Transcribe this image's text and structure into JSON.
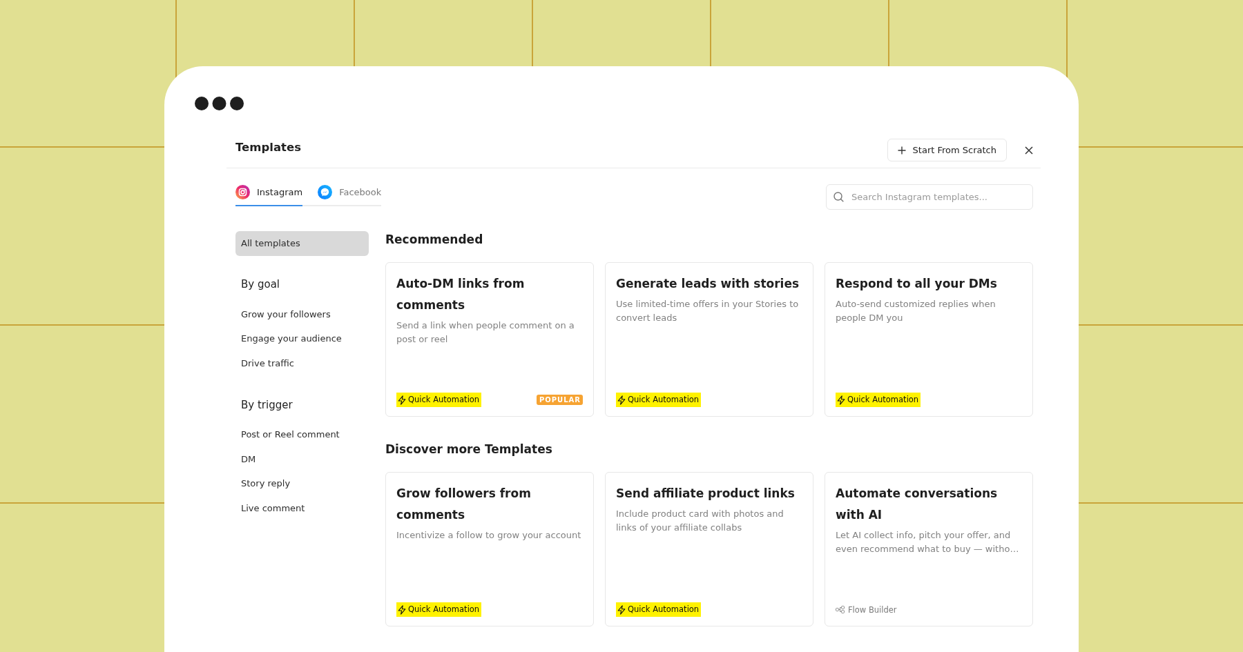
{
  "header": {
    "title": "Templates",
    "start_button": "Start From Scratch"
  },
  "tabs": [
    {
      "label": "Instagram",
      "kind": "camera",
      "selected": true
    },
    {
      "label": "Facebook",
      "kind": "chat",
      "selected": false
    }
  ],
  "search": {
    "placeholder": "Search Instagram templates..."
  },
  "sidebar": {
    "items": [
      {
        "label": "All templates",
        "selected": true
      }
    ],
    "groups": [
      {
        "title": "By goal",
        "items": [
          {
            "label": "Grow your followers",
            "selected": false
          },
          {
            "label": "Engage your audience",
            "selected": false
          },
          {
            "label": "Drive traffic",
            "selected": false
          }
        ]
      },
      {
        "title": "By trigger",
        "items": [
          {
            "label": "Post or Reel comment",
            "selected": false
          },
          {
            "label": "DM",
            "selected": false
          },
          {
            "label": "Story reply",
            "selected": false
          },
          {
            "label": "Live comment",
            "selected": false
          }
        ]
      }
    ]
  },
  "sections": [
    {
      "title": "Recommended",
      "cards": [
        {
          "title": "Auto-DM links from comments",
          "description": "Send a link when people comment on a post or reel",
          "tag": {
            "kind": "quick",
            "label": "Quick Automation"
          },
          "popular_badge": "POPULAR"
        },
        {
          "title": "Generate leads with stories",
          "description": "Use limited-time offers in your Stories to convert leads",
          "tag": {
            "kind": "quick",
            "label": "Quick Automation"
          }
        },
        {
          "title": "Respond to all your DMs",
          "description": "Auto-send customized replies when people DM you",
          "tag": {
            "kind": "quick",
            "label": "Quick Automation"
          }
        }
      ]
    },
    {
      "title": "Discover more Templates",
      "cards": [
        {
          "title": "Grow followers from comments",
          "description": "Incentivize a follow to grow your account",
          "tag": {
            "kind": "quick",
            "label": "Quick Automation"
          }
        },
        {
          "title": "Send affiliate product links",
          "description": "Include product card with photos and links of your affiliate collabs",
          "tag": {
            "kind": "quick",
            "label": "Quick Automation"
          }
        },
        {
          "title": "Automate conversations with AI",
          "description": "Let AI collect info, pitch your offer, and even recommend what to buy — witho…",
          "tag": {
            "kind": "flow",
            "label": "Flow Builder"
          }
        }
      ]
    }
  ]
}
